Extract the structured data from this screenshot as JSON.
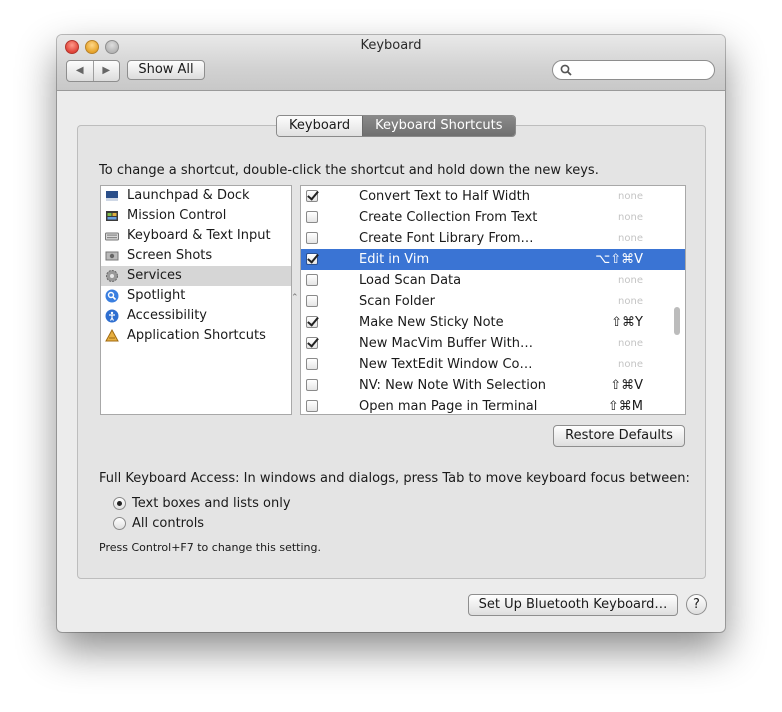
{
  "window": {
    "title": "Keyboard"
  },
  "toolbar": {
    "back_glyph": "◀",
    "forward_glyph": "▶",
    "show_all_label": "Show All",
    "search_value": "",
    "search_placeholder": ""
  },
  "tabs": [
    {
      "label": "Keyboard",
      "active": false
    },
    {
      "label": "Keyboard Shortcuts",
      "active": true
    }
  ],
  "instructions": "To change a shortcut, double-click the shortcut and hold down the new keys.",
  "categories": [
    {
      "label": "Launchpad & Dock",
      "icon": "launchpad-dock-icon"
    },
    {
      "label": "Mission Control",
      "icon": "mission-control-icon"
    },
    {
      "label": "Keyboard & Text Input",
      "icon": "keyboard-icon"
    },
    {
      "label": "Screen Shots",
      "icon": "screen-shots-icon"
    },
    {
      "label": "Services",
      "icon": "services-gear-icon",
      "selected": true
    },
    {
      "label": "Spotlight",
      "icon": "spotlight-icon"
    },
    {
      "label": "Accessibility",
      "icon": "accessibility-icon"
    },
    {
      "label": "Application Shortcuts",
      "icon": "app-shortcuts-icon"
    }
  ],
  "resize_glyph": "⌃",
  "shortcuts": [
    {
      "name": "Convert Text to Half Width",
      "checked": true,
      "key": "none"
    },
    {
      "name": "Create Collection From Text",
      "checked": false,
      "key": "none"
    },
    {
      "name": "Create Font Library From…",
      "checked": false,
      "key": "none"
    },
    {
      "name": "Edit in Vim",
      "checked": true,
      "key": "⌥⇧⌘V",
      "selected": true
    },
    {
      "name": "Load Scan Data",
      "checked": false,
      "key": "none"
    },
    {
      "name": "Scan Folder",
      "checked": false,
      "key": "none"
    },
    {
      "name": "Make New Sticky Note",
      "checked": true,
      "key": "⇧⌘Y"
    },
    {
      "name": "New MacVim Buffer With…",
      "checked": true,
      "key": "none"
    },
    {
      "name": "New TextEdit Window Co…",
      "checked": false,
      "key": "none"
    },
    {
      "name": "NV: New Note With Selection",
      "checked": false,
      "key": "⇧⌘V"
    },
    {
      "name": "Open man Page in Terminal",
      "checked": false,
      "key": "⇧⌘M"
    }
  ],
  "restore_defaults_label": "Restore Defaults",
  "full_keyboard_access": {
    "text": "Full Keyboard Access: In windows and dialogs, press Tab to move keyboard focus between:",
    "options": [
      {
        "label": "Text boxes and lists only",
        "selected": true
      },
      {
        "label": "All controls",
        "selected": false
      }
    ],
    "note": "Press Control+F7 to change this setting."
  },
  "bluetooth_button_label": "Set Up Bluetooth Keyboard…",
  "help_label": "?",
  "colors": {
    "selection": "#3a74d4",
    "window_bg": "#ececec"
  }
}
